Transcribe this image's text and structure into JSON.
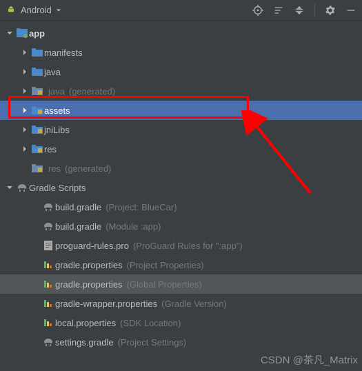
{
  "toolbar": {
    "view": "Android"
  },
  "tree": {
    "app": {
      "label": "app",
      "children": {
        "manifests": "manifests",
        "java": "java",
        "java_gen_label": "java",
        "java_gen_suffix": "(generated)",
        "assets": "assets",
        "jniLibs": "jniLibs",
        "res": "res",
        "res_gen_label": "res",
        "res_gen_suffix": "(generated)"
      }
    },
    "gradle_scripts": {
      "label": "Gradle Scripts",
      "items": [
        {
          "name": "build.gradle",
          "suffix": "(Project: BlueCar)"
        },
        {
          "name": "build.gradle",
          "suffix": "(Module :app)"
        },
        {
          "name": "proguard-rules.pro",
          "suffix": "(ProGuard Rules for \":app\")"
        },
        {
          "name": "gradle.properties",
          "suffix": "(Project Properties)"
        },
        {
          "name": "gradle.properties",
          "suffix": "(Global Properties)"
        },
        {
          "name": "gradle-wrapper.properties",
          "suffix": "(Gradle Version)"
        },
        {
          "name": "local.properties",
          "suffix": "(SDK Location)"
        },
        {
          "name": "settings.gradle",
          "suffix": "(Project Settings)"
        }
      ]
    }
  },
  "watermark": "CSDN @茶凡_Matrix"
}
